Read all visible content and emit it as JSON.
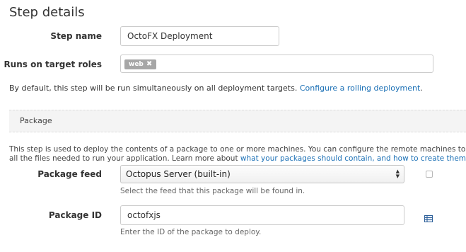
{
  "page": {
    "title": "Step details"
  },
  "step_name": {
    "label": "Step name",
    "value": "OctoFX Deployment"
  },
  "target_roles": {
    "label": "Runs on target roles",
    "tags": [
      "web"
    ]
  },
  "rolling": {
    "text": "By default, this step will be run simultaneously on all deployment targets.",
    "link": "Configure a rolling deployment",
    "suffix": "."
  },
  "package_section": {
    "title": "Package",
    "description_line1": "This step is used to deploy the contents of a package to one or more machines. You can configure the remote machines to deploy to in the",
    "description_line2_prefix": "all the files needed to run your application. Learn more about",
    "description_link": "what your packages should contain, and how to create them",
    "description_line2_suffix": "."
  },
  "package_feed": {
    "label": "Package feed",
    "selected": "Octopus Server (built-in)",
    "hint": "Select the feed that this package will be found in."
  },
  "package_id": {
    "label": "Package ID",
    "value": "octofxjs",
    "hint": "Enter the ID of the package to deploy."
  },
  "icons": {
    "tag_remove": "close-icon",
    "select": "updown-arrows-icon",
    "library": "package-library-icon"
  },
  "colors": {
    "link": "#1a6fb5",
    "tag": "#a6a6a6",
    "section_bg": "#f4f4f4"
  }
}
